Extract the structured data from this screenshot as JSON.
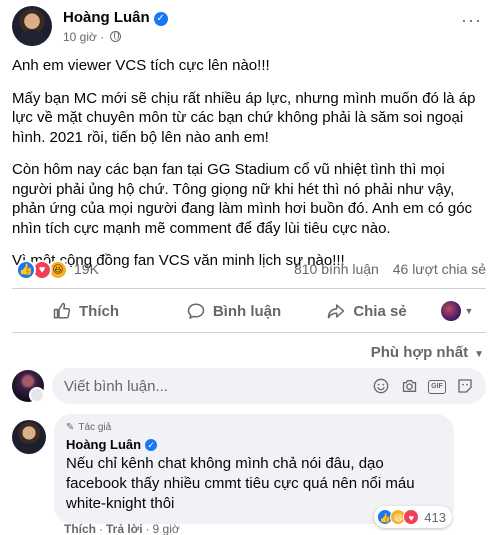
{
  "post": {
    "author": "Hoàng Luân",
    "time": "10 giờ",
    "paragraphs": [
      "Anh em viewer VCS tích cực lên nào!!!",
      "Mấy bạn MC mới sẽ chịu rất nhiều áp lực, nhưng mình muốn đó là áp lực về mặt chuyên môn từ các bạn chứ không phải là săm soi ngoại hình. 2021 rồi, tiến bộ lên nào anh em!",
      "Còn hôm nay các bạn fan tại GG Stadium cổ vũ nhiệt tình thì mọi người phải ủng hộ chứ. Tông giọng nữ khi hét thì nó phải như vậy, phản ứng của mọi người đang làm mình hơi buồn đó. Anh em có góc nhìn tích cực mạnh mẽ comment để đẩy lùi tiêu cực nào.",
      "Vì một cộng đồng fan VCS văn minh lịch sự nào!!!"
    ]
  },
  "stats": {
    "reactions": "19K",
    "comments": "810 bình luận",
    "shares": "46 lượt chia sẻ"
  },
  "actions": {
    "like": "Thích",
    "comment": "Bình luận",
    "share": "Chia sẻ"
  },
  "sort_label": "Phù hợp nhất",
  "composer": {
    "placeholder": "Viết bình luận..."
  },
  "comment": {
    "tag": "Tác giả",
    "author": "Hoàng Luân",
    "text": "Nếu chỉ kênh chat không mình chả nói đâu, dạo facebook thấy nhiều cmmt tiêu cực quá nên nổi máu white-knight thôi",
    "reactions": "413",
    "like": "Thích",
    "reply": "Trả lời",
    "time": "9 giờ"
  },
  "icons": {
    "like": "thumbs-up-icon",
    "love": "heart-icon",
    "haha": "laugh-icon",
    "comment": "speech-bubble-icon",
    "share": "share-arrow-icon",
    "more": "ellipsis-icon",
    "globe": "globe-icon"
  },
  "colors": {
    "accent": "#1877f2",
    "love": "#f33e58",
    "haha": "#f7b125",
    "muted": "#65676b"
  }
}
